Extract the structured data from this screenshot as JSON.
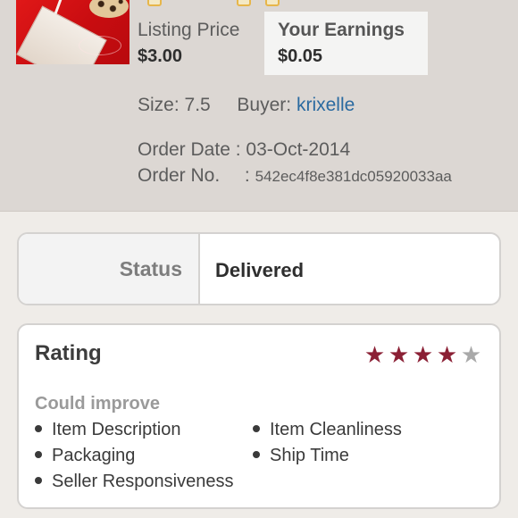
{
  "listing": {
    "price_label": "Listing Price",
    "price_value": "$3.00",
    "earnings_label": "Your Earnings",
    "earnings_value": "$0.05",
    "size_label": "Size:",
    "size_value": "7.5",
    "buyer_label": "Buyer:",
    "buyer_name": "krixelle",
    "order_date_label": "Order Date :",
    "order_date_value": "03-Oct-2014",
    "order_no_label": "Order No.",
    "order_no_sep": ":",
    "order_no_value": "542ec4f8e381dc05920033aa"
  },
  "status": {
    "label": "Status",
    "value": "Delivered"
  },
  "rating": {
    "title": "Rating",
    "stars": 4,
    "max_stars": 5,
    "filled_color": "#8b2035",
    "empty_color": "#a9a9a9",
    "improve_label": "Could improve",
    "items": [
      "Item Description",
      "Item Cleanliness",
      "Packaging",
      "Ship Time",
      "Seller Responsiveness"
    ]
  },
  "colors": {
    "link": "#2a6aa0",
    "top_bg": "#dcd7d3"
  }
}
